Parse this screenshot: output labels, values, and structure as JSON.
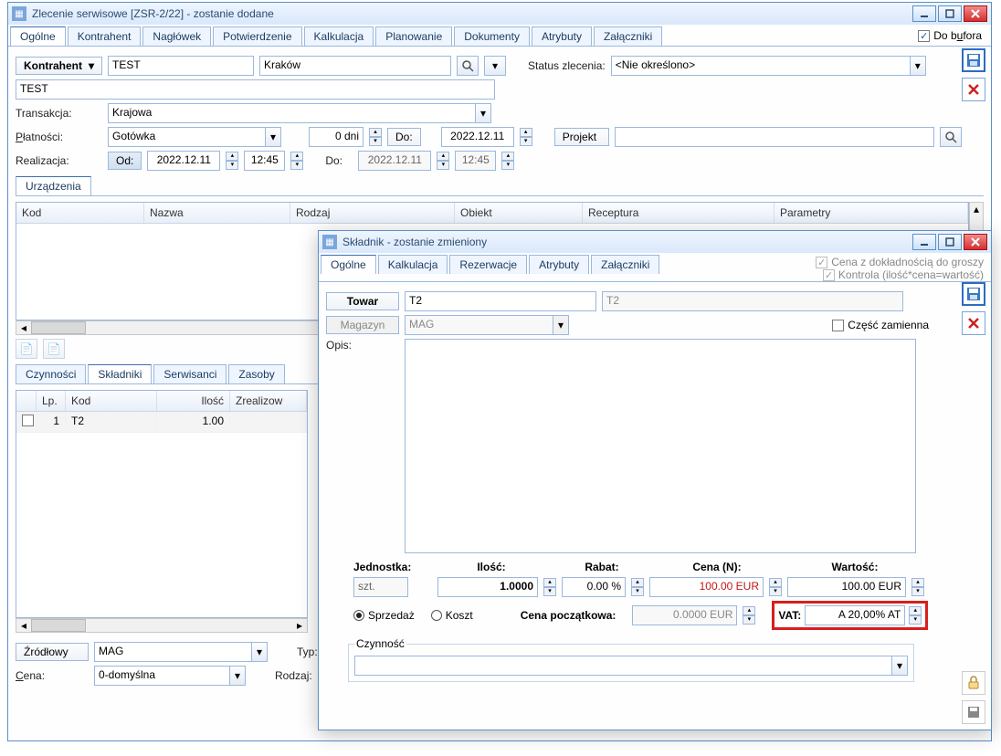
{
  "main": {
    "title": "Zlecenie serwisowe [ZSR-2/22]  - zostanie dodane",
    "do_bufora": "Do bufora",
    "do_bufora_underline": "u",
    "tabs": [
      "Ogólne",
      "Kontrahent",
      "Nagłówek",
      "Potwierdzenie",
      "Kalkulacja",
      "Planowanie",
      "Dokumenty",
      "Atrybuty",
      "Załączniki"
    ],
    "tab_active": 0,
    "kontrahent_btn": "Kontrahent",
    "kontrahent_val": "TEST",
    "kontrahent_city": "Kraków",
    "kontrahent_sub": "TEST",
    "status_lbl": "Status zlecenia:",
    "status_val": "<Nie określono>",
    "transakcja_lbl": "Transakcja:",
    "transakcja_val": "Krajowa",
    "platnosci_lbl": "Płatności:",
    "platnosci_val": "Gotówka",
    "dni_val": "0 dni",
    "do_lbl": "Do:",
    "do_date": "2022.12.11",
    "projekt_btn": "Projekt",
    "realizacja_lbl": "Realizacja:",
    "od_btn": "Od:",
    "od_date": "2022.12.11",
    "od_time": "12:45",
    "do2_lbl": "Do:",
    "do2_date": "2022.12.11",
    "do2_time": "12:45",
    "urzadzenia_tab": "Urządzenia",
    "grid1_headers": [
      "Kod",
      "Nazwa",
      "Rodzaj",
      "Obiekt",
      "Receptura",
      "Parametry"
    ],
    "bottom_tabs": [
      "Czynności",
      "Składniki",
      "Serwisanci",
      "Zasoby"
    ],
    "bottom_tab_active": 1,
    "grid2_headers": [
      "Lp.",
      "Kod",
      "Ilość",
      "Zrealizow"
    ],
    "grid2_row": {
      "lp": "1",
      "kod": "T2",
      "ilosc": "1.00"
    },
    "zrodlowy_lbl": "Źródłowy",
    "zrodlowy_val": "MAG",
    "typ_lbl": "Typ:",
    "cena_lbl": "Cena:",
    "cena_val": "0-domyślna",
    "rodzaj_lbl": "Rodzaj:"
  },
  "sub": {
    "title": "Składnik - zostanie zmieniony",
    "chk1": "Cena z dokładnością do groszy",
    "chk2": "Kontrola (ilość*cena=wartość)",
    "tabs": [
      "Ogólne",
      "Kalkulacja",
      "Rezerwacje",
      "Atrybuty",
      "Załączniki"
    ],
    "tab_active": 0,
    "towar_btn": "Towar",
    "towar_val": "T2",
    "towar_name": "T2",
    "magazyn_btn": "Magazyn",
    "magazyn_val": "MAG",
    "czesc_zamienna": "Część zamienna",
    "opis_lbl": "Opis:",
    "jednostka_lbl": "Jednostka:",
    "jednostka_val": "szt.",
    "ilosc_lbl": "Ilość:",
    "ilosc_val": "1.0000",
    "rabat_lbl": "Rabat:",
    "rabat_val": "0.00 %",
    "cenaN_lbl": "Cena (N):",
    "cenaN_val": "100.00 EUR",
    "wartosc_lbl": "Wartość:",
    "wartosc_val": "100.00 EUR",
    "sprzedaz": "Sprzedaż",
    "koszt": "Koszt",
    "cena_pocz_lbl": "Cena początkowa:",
    "cena_pocz_val": "0.0000 EUR",
    "vat_lbl": "VAT:",
    "vat_val": "A 20,00% AT",
    "czynnosc_lbl": "Czynność"
  }
}
